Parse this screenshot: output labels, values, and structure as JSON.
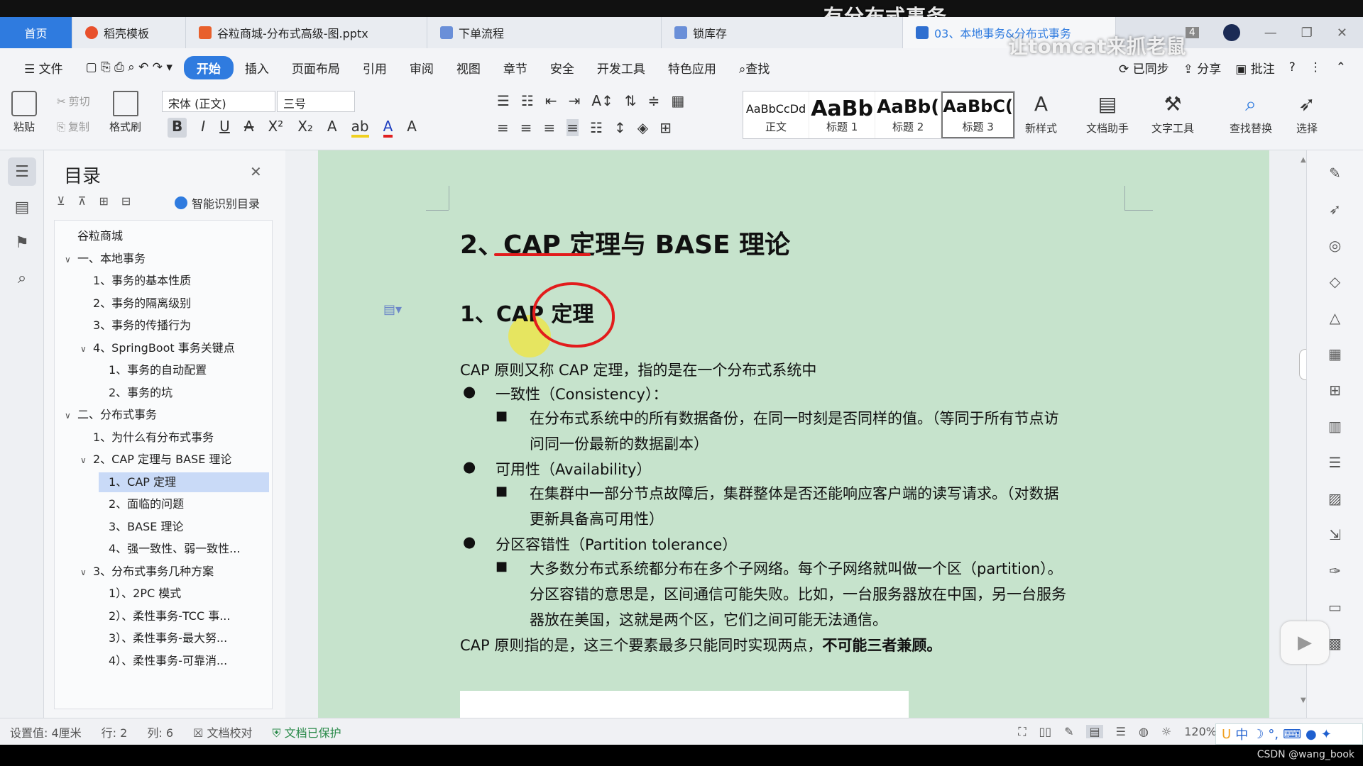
{
  "overlay": {
    "title": "有分布式事务",
    "subtitle": "让tomcat来抓老鼠"
  },
  "tabs": [
    {
      "label": "首页"
    },
    {
      "label": "稻壳模板"
    },
    {
      "label": "谷粒商城-分布式高级-图.pptx"
    },
    {
      "label": "下单流程"
    },
    {
      "label": "锁库存"
    },
    {
      "label": "03、本地事务&分布式事务"
    }
  ],
  "tab_badge": "4",
  "menu": {
    "file": "文件",
    "items": [
      "开始",
      "插入",
      "页面布局",
      "引用",
      "审阅",
      "视图",
      "章节",
      "安全",
      "开发工具",
      "特色应用"
    ],
    "search": "查找",
    "synced": "已同步",
    "share": "分享",
    "comment": "批注"
  },
  "ribbon": {
    "paste": "粘贴",
    "cut": "剪切",
    "copy": "复制",
    "format_painter": "格式刷",
    "font": "宋体 (正文)",
    "size": "三号",
    "styles": [
      {
        "sample": "AaBbCcDd",
        "label": "正文"
      },
      {
        "sample": "AaBb",
        "label": "标题 1"
      },
      {
        "sample": "AaBb(",
        "label": "标题 2"
      },
      {
        "sample": "AaBbC(",
        "label": "标题 3"
      }
    ],
    "new_style": "新样式",
    "doc_assistant": "文档助手",
    "text_tools": "文字工具",
    "find_replace": "查找替换",
    "select": "选择"
  },
  "toc": {
    "title": "目录",
    "smart": "智能识别目录",
    "items": [
      {
        "label": "谷粒商城",
        "level": 0,
        "caret": ""
      },
      {
        "label": "一、本地事务",
        "level": 0,
        "caret": "v"
      },
      {
        "label": "1、事务的基本性质",
        "level": 1,
        "caret": ""
      },
      {
        "label": "2、事务的隔离级别",
        "level": 1,
        "caret": ""
      },
      {
        "label": "3、事务的传播行为",
        "level": 1,
        "caret": ""
      },
      {
        "label": "4、SpringBoot 事务关键点",
        "level": 1,
        "caret": "v"
      },
      {
        "label": "1、事务的自动配置",
        "level": 2,
        "caret": ""
      },
      {
        "label": "2、事务的坑",
        "level": 2,
        "caret": ""
      },
      {
        "label": "二、分布式事务",
        "level": 0,
        "caret": "v"
      },
      {
        "label": "1、为什么有分布式事务",
        "level": 1,
        "caret": ""
      },
      {
        "label": "2、CAP 定理与 BASE 理论",
        "level": 1,
        "caret": "v"
      },
      {
        "label": "1、CAP 定理",
        "level": 2,
        "caret": "",
        "selected": true
      },
      {
        "label": "2、面临的问题",
        "level": 2,
        "caret": ""
      },
      {
        "label": "3、BASE 理论",
        "level": 2,
        "caret": ""
      },
      {
        "label": "4、强一致性、弱一致性...",
        "level": 2,
        "caret": ""
      },
      {
        "label": "3、分布式事务几种方案",
        "level": 1,
        "caret": "v"
      },
      {
        "label": "1）、2PC 模式",
        "level": 2,
        "caret": ""
      },
      {
        "label": "2）、柔性事务-TCC 事...",
        "level": 2,
        "caret": ""
      },
      {
        "label": "3）、柔性事务-最大努...",
        "level": 2,
        "caret": ""
      },
      {
        "label": "4）、柔性事务-可靠消...",
        "level": 2,
        "caret": ""
      }
    ]
  },
  "doc": {
    "h1": "2、CAP 定理与 BASE 理论",
    "h2": "1、CAP 定理",
    "intro": "CAP 原则又称 CAP 定理，指的是在一个分布式系统中",
    "b1": "一致性（Consistency）：",
    "b1s1": "在分布式系统中的所有数据备份，在同一时刻是否同样的值。（等同于所有节点访",
    "b1s2": "问同一份最新的数据副本）",
    "b2": "可用性（Availability）",
    "b2s1": "在集群中一部分节点故障后，集群整体是否还能响应客户端的读写请求。（对数据",
    "b2s2": "更新具备高可用性）",
    "b3": "分区容错性（Partition tolerance）",
    "b3s1": "大多数分布式系统都分布在多个子网络。每个子网络就叫做一个区（partition）。",
    "b3s2": "分区容错的意思是，区间通信可能失败。比如，一台服务器放在中国，另一台服务",
    "b3s3": "器放在美国，这就是两个区，它们之间可能无法通信。",
    "conclusion": "CAP 原则指的是，这三个要素最多只能同时实现两点，",
    "conclusion_bold": "不可能三者兼顾。"
  },
  "status": {
    "setting": "设置值: 4厘米",
    "line": "行: 2",
    "col": "列: 6",
    "proof": "文档校对",
    "protected": "文档已保护",
    "zoom": "120%"
  },
  "ime": "中",
  "watermark": "CSDN @wang_book",
  "colors": {
    "accent": "#2f7bdf",
    "doc_bg": "#c6e3cc",
    "ink": "#e21c1c"
  }
}
